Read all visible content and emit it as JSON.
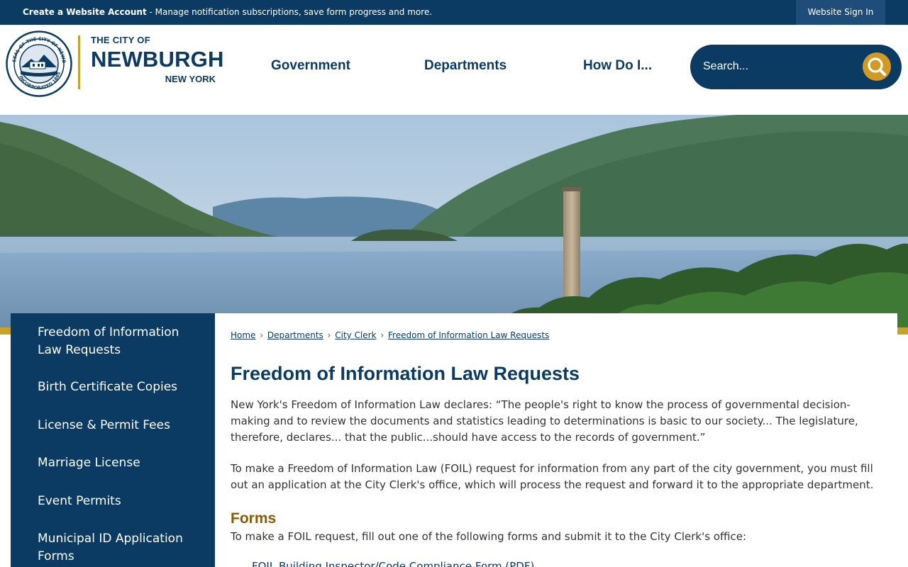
{
  "topbar": {
    "create_account": "Create a Website Account",
    "message": " - Manage notification subscriptions, save form progress and more.",
    "signin": "Website Sign In"
  },
  "logo": {
    "the_city_of": "THE CITY OF",
    "name": "NEWBURGH",
    "state": "NEW YORK",
    "seal_text_top": "SEAL OF THE CITY OF NEWBURGH, N.Y.",
    "seal_text_bottom": "INCORPORATED 1865"
  },
  "nav": {
    "government": "Government",
    "departments": "Departments",
    "how_do_i": "How Do I..."
  },
  "search": {
    "placeholder": "Search..."
  },
  "sidebar": {
    "items": [
      {
        "label": "Freedom of Information Law Requests"
      },
      {
        "label": "Birth Certificate Copies"
      },
      {
        "label": "License & Permit Fees"
      },
      {
        "label": "Marriage License"
      },
      {
        "label": "Event Permits"
      },
      {
        "label": "Municipal ID Application Forms"
      }
    ]
  },
  "breadcrumb": {
    "items": [
      "Home",
      "Departments",
      "City Clerk",
      "Freedom of Information Law Requests"
    ],
    "separator": "›"
  },
  "main": {
    "title": "Freedom of Information Law Requests",
    "paragraph1": "New York's Freedom of Information Law declares: “The people's right to know the process of governmental decision-making and to review the documents and statistics leading to determinations is basic to our society... The legislature, therefore, declares... that the public...should have access to the records of government.”",
    "paragraph2": "To make a Freedom of Information Law (FOIL) request for information from any part of the city government, you must fill out an application at the City Clerk's office, which will process the request and forward it to the appropriate department.",
    "forms_heading": "Forms",
    "forms_intro": "To make a FOIL request, fill out one of the following forms and submit it to the City Clerk's office:",
    "form_link_1": "FOIL Building Inspector/Code Compliance Form (PDF)"
  },
  "colors": {
    "navy": "#0b3a63",
    "gold": "#c9a227",
    "search_button": "#d29a22",
    "forms_heading": "#8a5a00"
  }
}
